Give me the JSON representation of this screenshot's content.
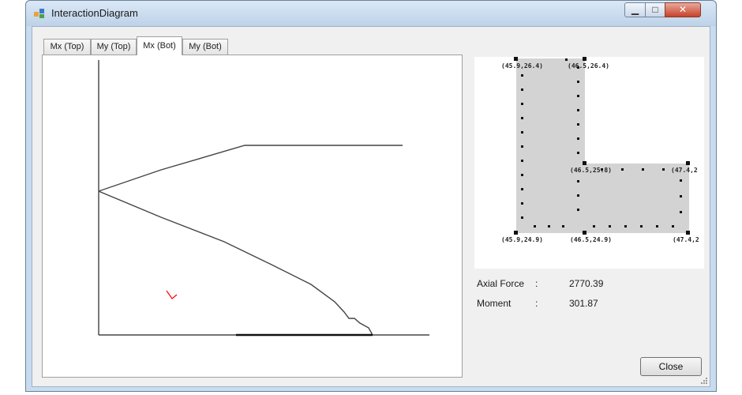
{
  "window": {
    "title": "InteractionDiagram",
    "min_glyph": "▁",
    "max_glyph": "□",
    "close_glyph": "✕"
  },
  "tabs": [
    {
      "label": "Mx (Top)",
      "active": false
    },
    {
      "label": "My (Top)",
      "active": false
    },
    {
      "label": "Mx (Bot)",
      "active": true
    },
    {
      "label": "My (Bot)",
      "active": false
    }
  ],
  "section": {
    "fill_color": "#d3d3d3",
    "labels": {
      "top_left": "(45.9,26.4)",
      "top_right": "(46.5,26.4)",
      "mid_left": "(46.5,25.8)",
      "mid_right": "(47.4,2",
      "bot_left": "(45.9,24.9)",
      "bot_mid": "(46.5,24.9)",
      "bot_right": "(47.4,2"
    }
  },
  "results": {
    "axial_label": "Axial Force",
    "axial_sep": ":",
    "axial_value": "2770.39",
    "moment_label": "Moment",
    "moment_sep": ":",
    "moment_value": "301.87"
  },
  "buttons": {
    "close_label": "Close"
  },
  "colors": {
    "curve": "#444444",
    "marker": "#ff0000",
    "frame": "#c9dcef"
  }
}
